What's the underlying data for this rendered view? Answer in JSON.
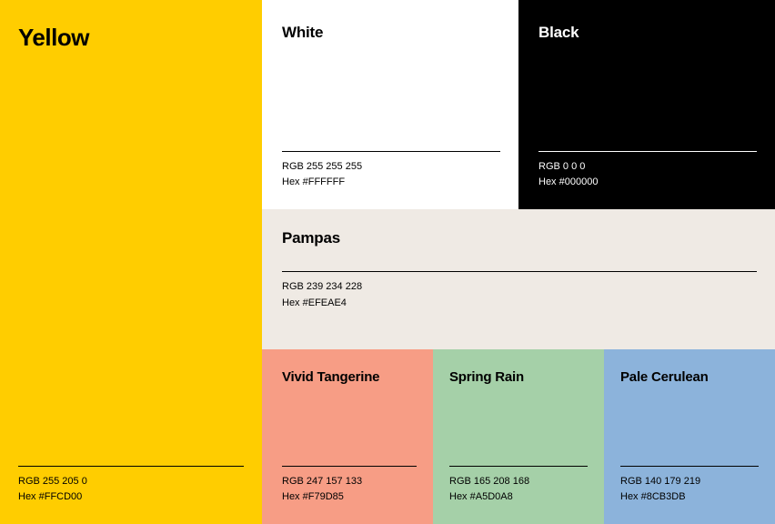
{
  "swatches": {
    "yellow": {
      "name": "Yellow",
      "rgb": "RGB 255 205 0",
      "hex": "Hex #FFCD00",
      "bg": "#FFCD00"
    },
    "white": {
      "name": "White",
      "rgb": "RGB 255 255 255",
      "hex": "Hex #FFFFFF",
      "bg": "#FFFFFF"
    },
    "black": {
      "name": "Black",
      "rgb": "RGB 0 0 0",
      "hex": "Hex #000000",
      "bg": "#000000"
    },
    "pampas": {
      "name": "Pampas",
      "rgb": "RGB 239 234 228",
      "hex": "Hex #EFEAE4",
      "bg": "#EFEAE4"
    },
    "tangerine": {
      "name": "Vivid Tangerine",
      "rgb": "RGB 247 157 133",
      "hex": "Hex #F79D85",
      "bg": "#F79D85"
    },
    "spring": {
      "name": "Spring Rain",
      "rgb": "RGB 165 208 168",
      "hex": "Hex #A5D0A8",
      "bg": "#A5D0A8"
    },
    "cerulean": {
      "name": "Pale Cerulean",
      "rgb": "RGB 140 179 219",
      "hex": "Hex #8CB3DB",
      "bg": "#8CB3DB"
    }
  }
}
